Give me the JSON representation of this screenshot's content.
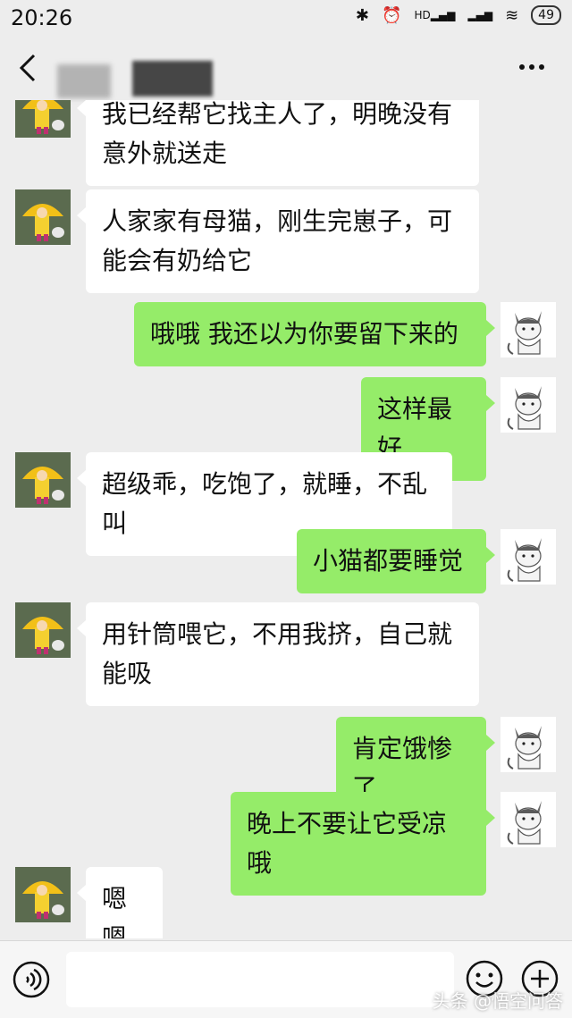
{
  "status_bar": {
    "time": "20:26",
    "network_label": "HD",
    "battery": "49",
    "icons": [
      "bluetooth-icon",
      "alarm-icon",
      "signal-icon",
      "signal-icon",
      "wifi-icon",
      "battery-icon"
    ]
  },
  "title_bar": {
    "icons": [
      "back-arrow-icon",
      "more-dots-icon"
    ]
  },
  "messages": [
    {
      "side": "in",
      "text": "我已经帮它找主人了，明晚没有意外就送走"
    },
    {
      "side": "in",
      "text": "人家家有母猫，刚生完崽子，可能会有奶给它"
    },
    {
      "side": "out",
      "text": "哦哦  我还以为你要留下来的"
    },
    {
      "side": "out",
      "text": "这样最好"
    },
    {
      "side": "in",
      "text": "超级乖，吃饱了，就睡，不乱叫"
    },
    {
      "side": "out",
      "text": "小猫都要睡觉"
    },
    {
      "side": "in",
      "text": "用针筒喂它，不用我挤，自己就能吸"
    },
    {
      "side": "out",
      "text": "肯定饿惨了"
    },
    {
      "side": "out",
      "text": "晚上不要让它受凉哦"
    },
    {
      "side": "in",
      "text": "嗯嗯"
    }
  ],
  "input_bar": {
    "placeholder": "",
    "icons": [
      "voice-icon",
      "emoji-icon",
      "plus-icon"
    ]
  },
  "watermark": "头条 @悟空问答",
  "colors": {
    "background": "#ededed",
    "incoming_bubble": "#ffffff",
    "outgoing_bubble": "#95ec69"
  }
}
